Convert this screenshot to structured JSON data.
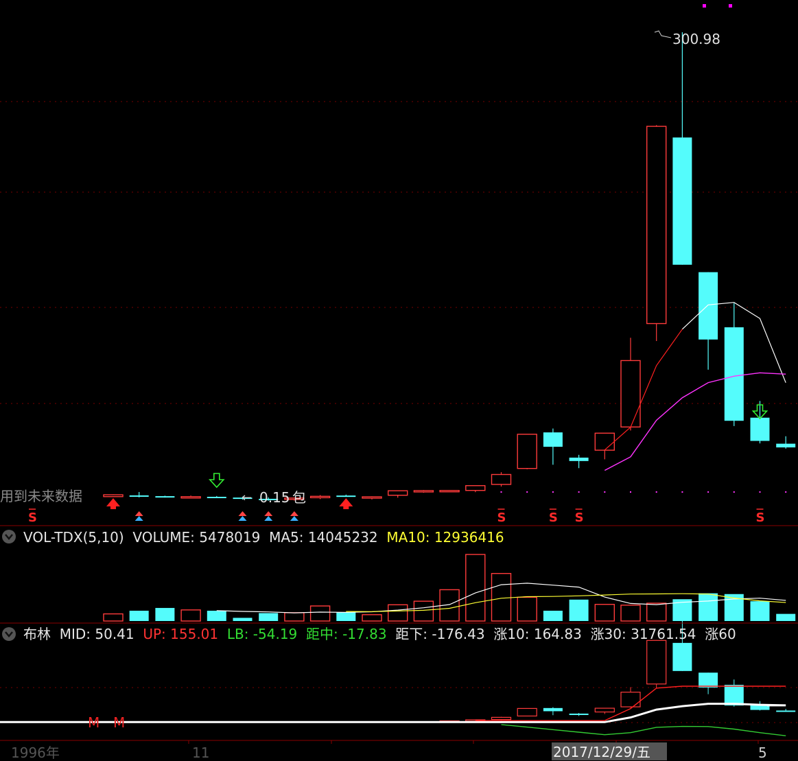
{
  "main_panel": {
    "peak_label": "300.98",
    "low_label": "0.15",
    "low_suffix": "包",
    "future_data_note": "用到未来数据"
  },
  "vol_panel": {
    "indicator": "VOL-TDX(5,10)",
    "fields": [
      {
        "label": "VOLUME:",
        "value": "5478019",
        "color": "#e6e6e6"
      },
      {
        "label": "MA5:",
        "value": "14045232",
        "color": "#e6e6e6"
      },
      {
        "label": "MA10:",
        "value": "12936416",
        "color": "#ffff33"
      }
    ]
  },
  "boll_panel": {
    "indicator": "布林",
    "fields": [
      {
        "label": "MID:",
        "value": "50.41",
        "color": "#e6e6e6"
      },
      {
        "label": "UP:",
        "value": "155.01",
        "color": "#ff3333"
      },
      {
        "label": "LB:",
        "value": "-54.19",
        "color": "#33dd33"
      },
      {
        "label": "距中:",
        "value": "-17.83",
        "color": "#33dd33"
      },
      {
        "label": "距下:",
        "value": "-176.43",
        "color": "#e6e6e6"
      },
      {
        "label": "涨10:",
        "value": "164.83",
        "color": "#e6e6e6"
      },
      {
        "label": "涨30:",
        "value": "31761.54",
        "color": "#e6e6e6"
      },
      {
        "label": "涨60",
        "value": "",
        "color": "#e6e6e6"
      }
    ],
    "markers": [
      "M",
      "M"
    ]
  },
  "time_axis": {
    "labels": [
      "1996年",
      "11",
      "5"
    ],
    "cursor_label": "2017/12/29/五"
  },
  "colors": {
    "up": "#ff3b3b",
    "down": "#54fcfc",
    "ma_red": "#ff2020",
    "ma_white": "#ffffff",
    "ma_magenta": "#ff33ff",
    "vol_ma5": "#ffffff",
    "vol_ma10": "#ffff33",
    "grid": "#7a0000"
  },
  "chart_data": {
    "type": "candlestick",
    "title": "",
    "candles": [
      {
        "o": 1.0,
        "h": 2.5,
        "l": 0.8,
        "c": 2.2
      },
      {
        "o": 1.8,
        "h": 4.0,
        "l": 0.5,
        "c": 1.2
      },
      {
        "o": 1.3,
        "h": 1.6,
        "l": 0.4,
        "c": 0.6
      },
      {
        "o": 0.9,
        "h": 1.7,
        "l": 0.4,
        "c": 1.0
      },
      {
        "o": 0.9,
        "h": 1.4,
        "l": 0.3,
        "c": 0.5
      },
      {
        "o": 0.4,
        "h": 1.0,
        "l": -0.9,
        "c": 0.1
      },
      {
        "o": -0.4,
        "h": 0.5,
        "l": -1.6,
        "c": -1.0
      },
      {
        "o": -0.8,
        "h": 0.4,
        "l": -1.5,
        "c": 0.1
      },
      {
        "o": 0.3,
        "h": 2.0,
        "l": -0.6,
        "c": 1.2
      },
      {
        "o": 1.7,
        "h": 2.3,
        "l": 1.1,
        "c": 1.4
      },
      {
        "o": 0.5,
        "h": 1.2,
        "l": -0.8,
        "c": 0.9
      },
      {
        "o": 1.9,
        "h": 4.2,
        "l": 0.3,
        "c": 4.8
      },
      {
        "o": 4.6,
        "h": 5.3,
        "l": 3.5,
        "c": 4.9
      },
      {
        "o": 4.7,
        "h": 5.2,
        "l": 4.1,
        "c": 5.0
      },
      {
        "o": 5.0,
        "h": 7.3,
        "l": 3.9,
        "c": 8.1
      },
      {
        "o": 8.9,
        "h": 16.8,
        "l": 7.5,
        "c": 15.3
      },
      {
        "o": 19.2,
        "h": 26.5,
        "l": 18.7,
        "c": 41.3
      },
      {
        "o": 42.5,
        "h": 45.0,
        "l": 21.6,
        "c": 33.2
      },
      {
        "o": 26.2,
        "h": 28.0,
        "l": 19.4,
        "c": 24.0
      },
      {
        "o": 31.0,
        "h": 37.0,
        "l": 25.1,
        "c": 42.0
      },
      {
        "o": 46.0,
        "h": 103.6,
        "l": 43.7,
        "c": 88.9
      },
      {
        "o": 112.8,
        "h": 241.0,
        "l": 101.5,
        "c": 240.2
      },
      {
        "o": 233.0,
        "h": 300.98,
        "l": 176.3,
        "c": 150.8
      },
      {
        "o": 146.0,
        "h": 146.0,
        "l": 83.0,
        "c": 102.5
      },
      {
        "o": 110.4,
        "h": 126.0,
        "l": 46.6,
        "c": 50.0
      },
      {
        "o": 52.0,
        "h": 62.8,
        "l": 35.4,
        "c": 37.0
      },
      {
        "o": 35.2,
        "h": 40.0,
        "l": 32.0,
        "c": 32.8
      }
    ],
    "volume": [
      18,
      26,
      33,
      28,
      26,
      8,
      20,
      21,
      38,
      22,
      16,
      41,
      50,
      79,
      168,
      120,
      60,
      26,
      54,
      42,
      40,
      45,
      55,
      70,
      68,
      50,
      18
    ],
    "boll_mid": [
      null,
      null,
      null,
      null,
      null,
      null,
      null,
      null,
      null,
      null,
      null,
      null,
      null,
      null,
      null,
      null,
      null,
      null,
      null,
      null,
      15,
      38,
      48,
      55,
      55,
      52,
      50.41
    ]
  }
}
